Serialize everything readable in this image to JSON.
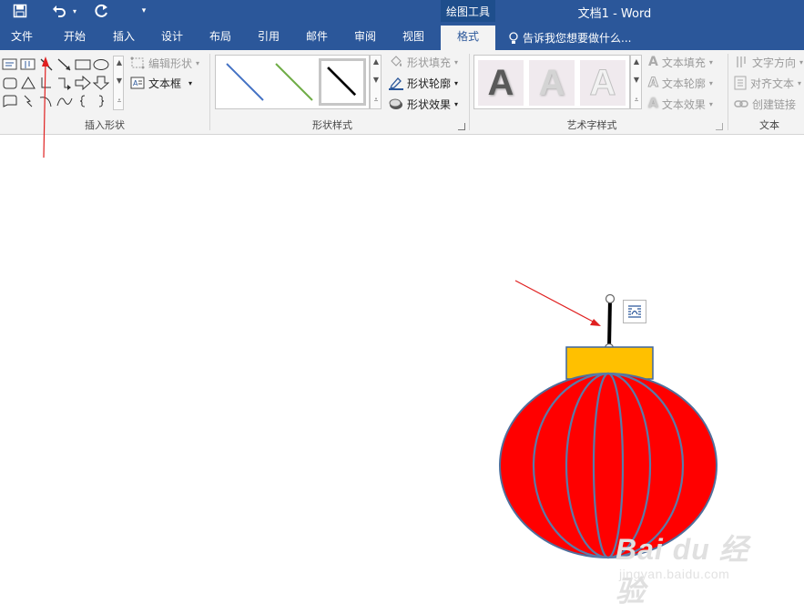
{
  "window": {
    "title": "文档1 - Word",
    "contextual_tab_group": "绘图工具",
    "quick_access": [
      "save-icon",
      "undo-icon",
      "undo-dropdown-icon",
      "redo-icon",
      "customize-qat-icon"
    ]
  },
  "tabs": [
    {
      "label": "文件"
    },
    {
      "label": "开始"
    },
    {
      "label": "插入"
    },
    {
      "label": "设计"
    },
    {
      "label": "布局"
    },
    {
      "label": "引用"
    },
    {
      "label": "邮件"
    },
    {
      "label": "审阅"
    },
    {
      "label": "视图"
    },
    {
      "label": "格式",
      "active": true
    }
  ],
  "tell_me": "告诉我您想要做什么...",
  "ribbon": {
    "insert_shapes": {
      "label": "插入形状",
      "edit_shape": "编辑形状",
      "text_box": "文本框"
    },
    "shape_styles": {
      "label": "形状样式",
      "fill": "形状填充",
      "outline": "形状轮廓",
      "effects": "形状效果",
      "swatch_colors": [
        "#4472c4",
        "#70ad47",
        "#000000"
      ]
    },
    "wordart_styles": {
      "label": "艺术字样式",
      "glyph": "A",
      "text_fill": "文本填充",
      "text_outline": "文本轮廓",
      "text_effects": "文本效果"
    },
    "text": {
      "label": "文本",
      "direction": "文字方向",
      "align": "对齐文本",
      "link": "创建链接"
    }
  },
  "colors": {
    "title_bar": "#2b579a",
    "ribbon_bg": "#f3f3f3",
    "lantern_body": "#ff0000",
    "lantern_ribs": "#5a7ba8",
    "lantern_cap": "#ffc000",
    "annotation_arrow": "#e02020"
  },
  "watermark": {
    "brand": "Bai du 经验",
    "url": "jingyan.baidu.com"
  }
}
